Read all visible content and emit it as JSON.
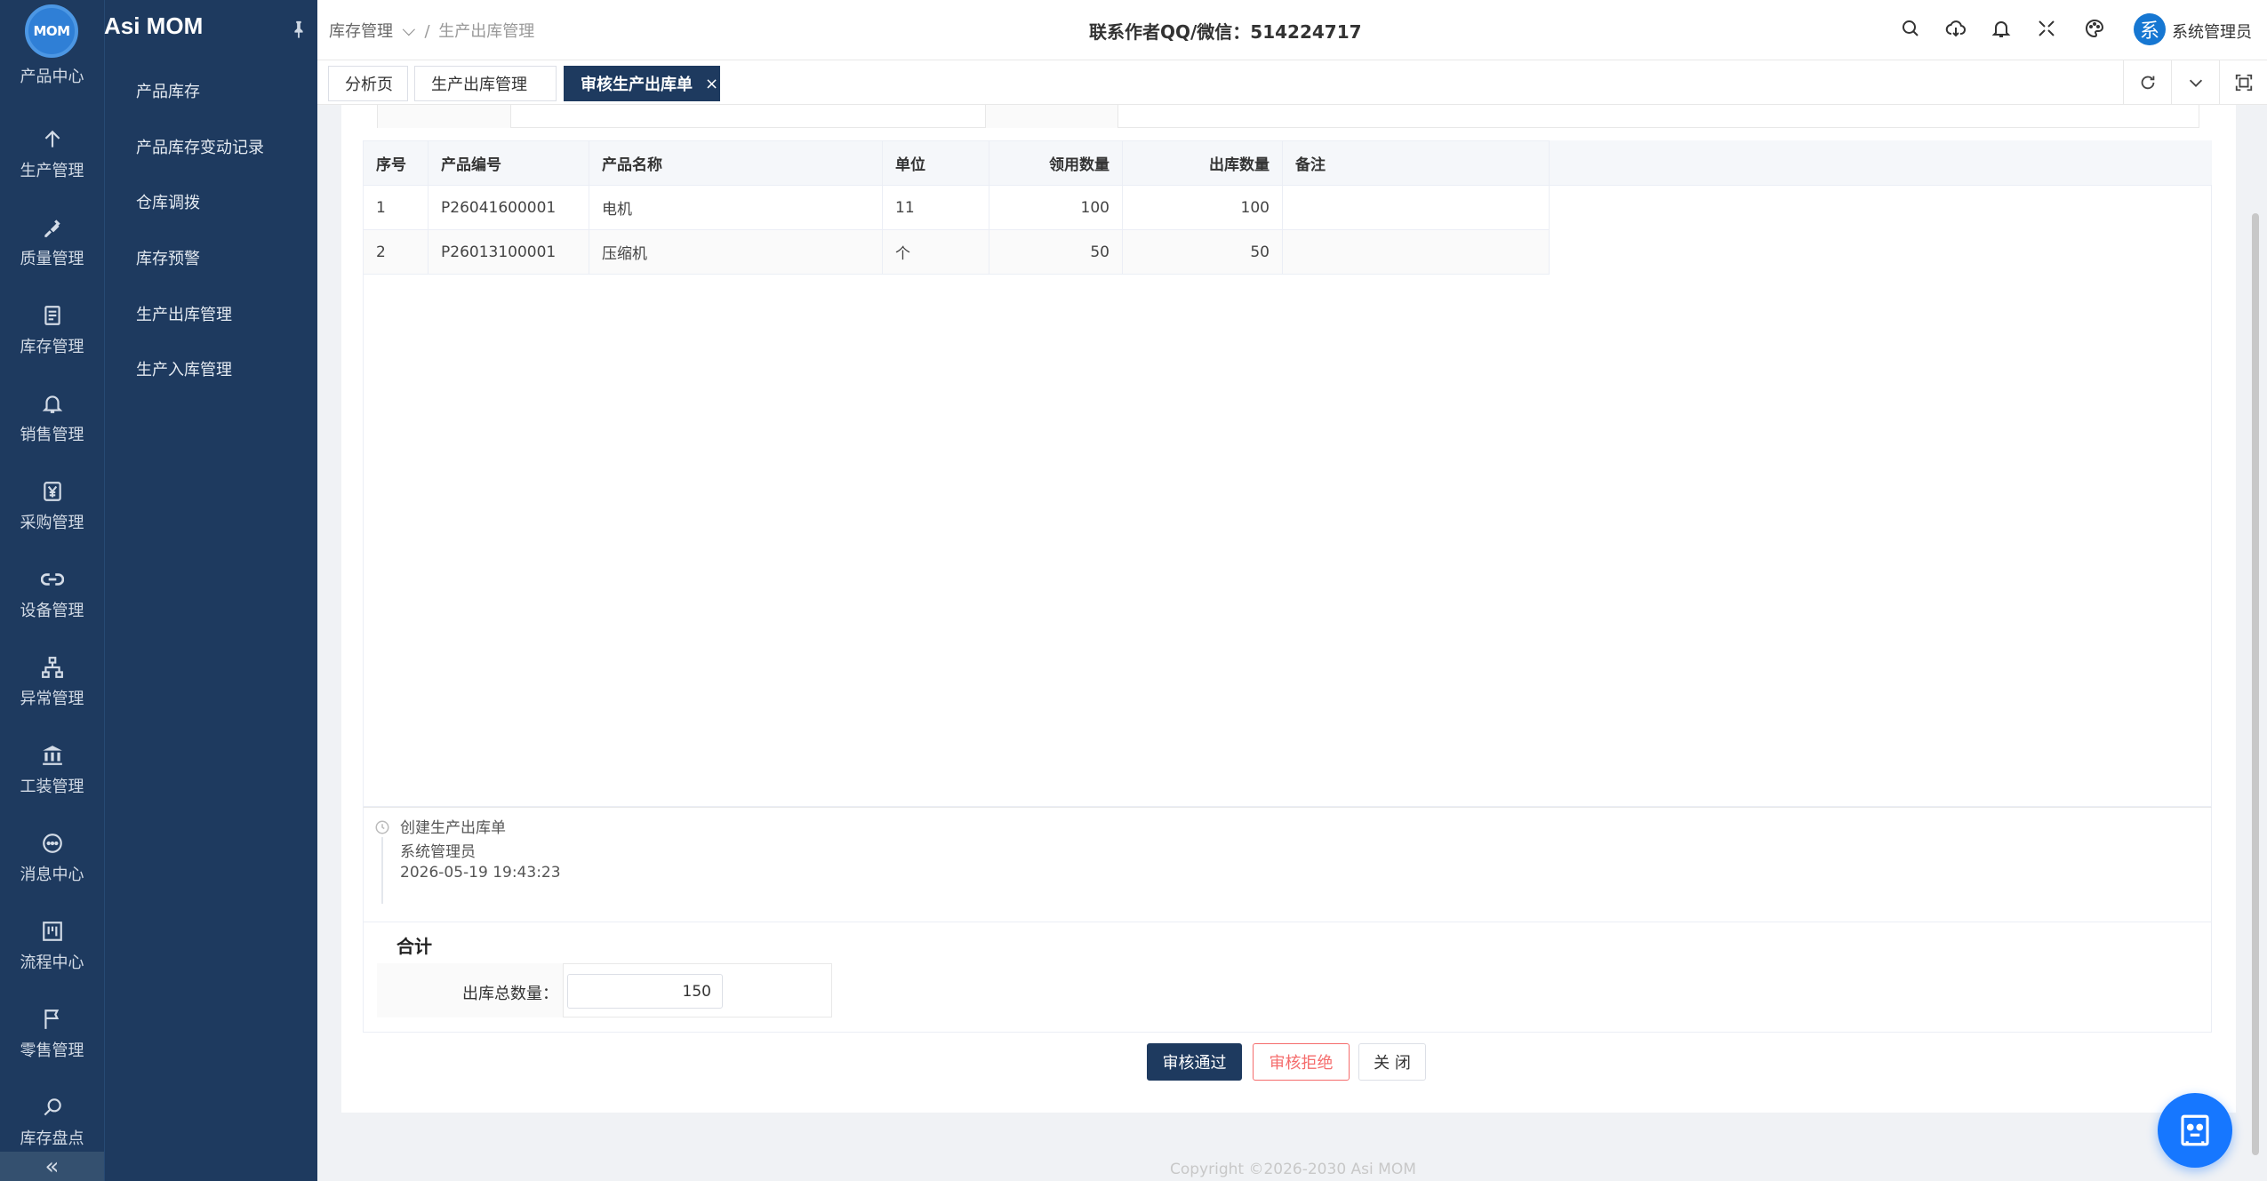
{
  "app": {
    "logo_text": "MOM",
    "title": "Asi MOM"
  },
  "rail": {
    "items": [
      {
        "label": "产品中心",
        "icon": "product-icon"
      },
      {
        "label": "生产管理",
        "icon": "arrow-up-icon"
      },
      {
        "label": "质量管理",
        "icon": "magnet-icon"
      },
      {
        "label": "库存管理",
        "icon": "document-icon"
      },
      {
        "label": "销售管理",
        "icon": "bell-icon"
      },
      {
        "label": "采购管理",
        "icon": "yen-icon"
      },
      {
        "label": "设备管理",
        "icon": "link-icon"
      },
      {
        "label": "异常管理",
        "icon": "org-icon"
      },
      {
        "label": "工装管理",
        "icon": "bank-icon"
      },
      {
        "label": "消息中心",
        "icon": "message-icon"
      },
      {
        "label": "流程中心",
        "icon": "board-icon"
      },
      {
        "label": "零售管理",
        "icon": "flag-icon"
      },
      {
        "label": "库存盘点",
        "icon": "search-doc-icon"
      }
    ],
    "collapse_glyph": "«"
  },
  "submenu": {
    "items": [
      {
        "label": "产品库存"
      },
      {
        "label": "产品库存变动记录"
      },
      {
        "label": "仓库调拨"
      },
      {
        "label": "库存预警"
      },
      {
        "label": "生产出库管理"
      },
      {
        "label": "生产入库管理"
      }
    ]
  },
  "header": {
    "breadcrumb": {
      "parent": "库存管理",
      "separator": "/",
      "current": "生产出库管理"
    },
    "contact": "联系作者QQ/微信：514224717",
    "avatar_char": "系",
    "user_name": "系统管理员"
  },
  "tabs": [
    {
      "label": "分析页"
    },
    {
      "label": "生产出库管理"
    },
    {
      "label": "审核生产出库单",
      "close": "×"
    }
  ],
  "detail_table": {
    "headers": [
      "序号",
      "产品编号",
      "产品名称",
      "单位",
      "领用数量",
      "出库数量",
      "备注"
    ],
    "rows": [
      [
        "1",
        "P26041600001",
        "电机",
        "11",
        "100",
        "100",
        ""
      ],
      [
        "2",
        "P26013100001",
        "压缩机",
        "个",
        "50",
        "50",
        ""
      ]
    ]
  },
  "timeline": {
    "event": "创建生产出库单",
    "operator": "系统管理员",
    "time": "2026-05-19 19:43:23"
  },
  "summary": {
    "title": "合计",
    "total_label": "出库总数量：",
    "total_value": "150"
  },
  "actions": {
    "approve": "审核通过",
    "reject": "审核拒绝",
    "close": "关 闭"
  },
  "footer": "Copyright ©2026-2030 Asi MOM",
  "colors": {
    "primary": "#1e3a5f",
    "danger": "#f56c6c",
    "accent": "#1677ff"
  }
}
